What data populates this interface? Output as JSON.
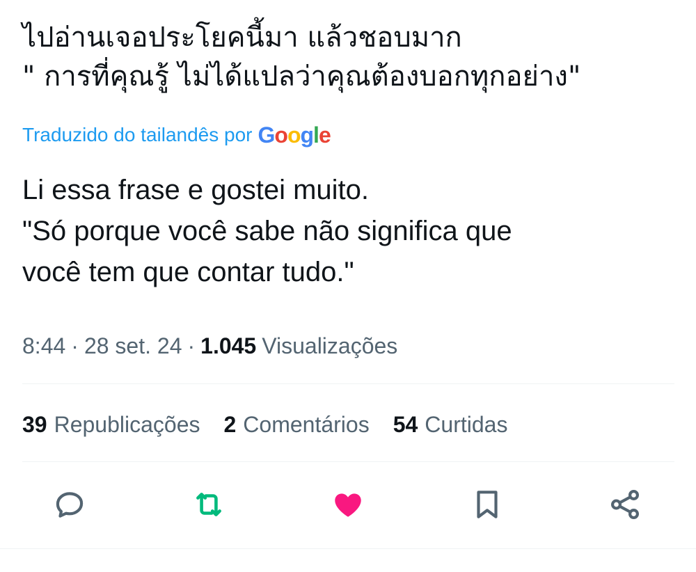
{
  "tweet": {
    "original_lines": [
      "ไปอ่านเจอประโยคนี้มา แล้วชอบมาก",
      "\" การที่คุณรู้ ไม่ได้แปลว่าคุณต้องบอกทุกอย่าง\""
    ],
    "translated_by": "Traduzido do tailandês por",
    "translator_logo": "Google",
    "translation_lines": [
      "Li essa frase e gostei muito.",
      "\"Só porque você sabe não significa que",
      "você tem que contar tudo.\""
    ],
    "time": "8:44",
    "separator": "·",
    "date": "28 set. 24",
    "views_count": "1.045",
    "views_label": "Visualizações"
  },
  "stats": [
    {
      "count": "39",
      "label": "Republicações"
    },
    {
      "count": "2",
      "label": "Comentários"
    },
    {
      "count": "54",
      "label": "Curtidas"
    }
  ],
  "actions": [
    {
      "name": "reply",
      "icon": "reply-icon",
      "color": "#536471"
    },
    {
      "name": "repost",
      "icon": "repost-icon",
      "color": "#00ba7c"
    },
    {
      "name": "like",
      "icon": "heart-icon",
      "color": "#f91880"
    },
    {
      "name": "bookmark",
      "icon": "bookmark-icon",
      "color": "#536471"
    },
    {
      "name": "share",
      "icon": "share-icon",
      "color": "#536471"
    }
  ],
  "colors": {
    "text": "#0f1419",
    "secondary": "#536471",
    "link": "#1d9bf0",
    "divider": "#eff3f4"
  }
}
